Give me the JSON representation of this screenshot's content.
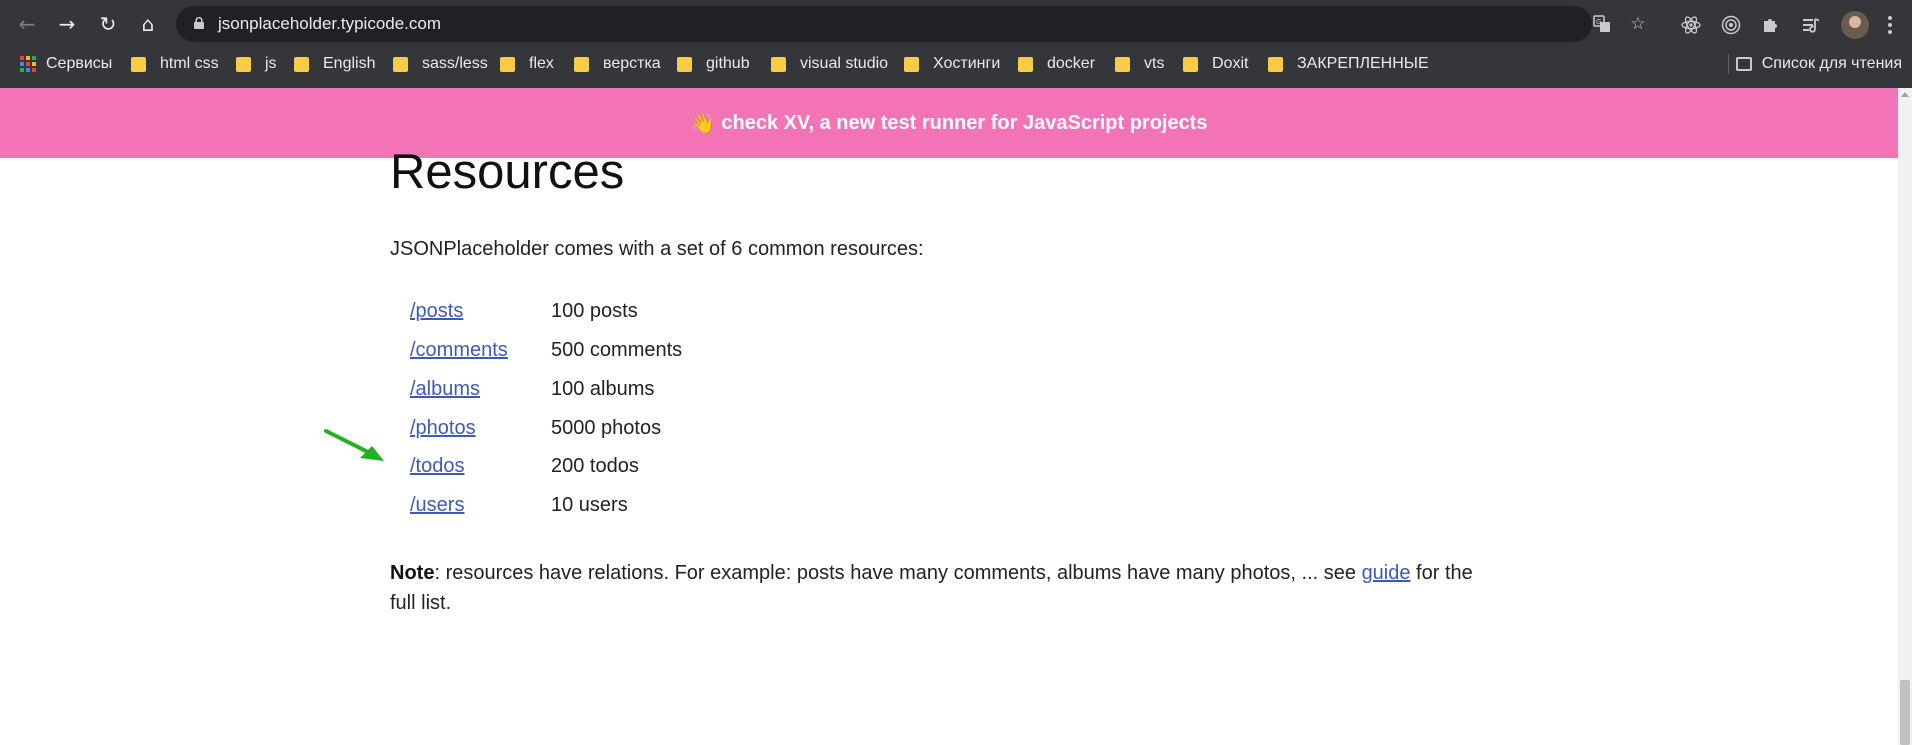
{
  "browser": {
    "url": "jsonplaceholder.typicode.com",
    "bookmarks": [
      {
        "label": "Сервисы"
      },
      {
        "label": "html css"
      },
      {
        "label": "js"
      },
      {
        "label": "English"
      },
      {
        "label": "sass/less"
      },
      {
        "label": "flex"
      },
      {
        "label": "верстка"
      },
      {
        "label": "github"
      },
      {
        "label": "visual studio"
      },
      {
        "label": "Хостинги"
      },
      {
        "label": "docker"
      },
      {
        "label": "vts"
      },
      {
        "label": "Doxit"
      },
      {
        "label": "ЗАКРЕПЛЕННЫЕ"
      }
    ],
    "reading_list": "Список для чтения",
    "icons": {
      "back": "back-arrow-icon",
      "forward": "forward-arrow-icon",
      "reload": "reload-icon",
      "home": "home-icon",
      "translate": "translate-icon",
      "bookmark": "star-icon",
      "react_devtools": "react-icon",
      "extension2": "target-icon",
      "extensions": "puzzle-icon",
      "media": "media-control-icon"
    }
  },
  "banner": {
    "emoji": "👋",
    "text": "check XV, a new test runner for JavaScript projects",
    "color": "#f374b6"
  },
  "page": {
    "heading": "Resources",
    "intro": "JSONPlaceholder comes with a set of 6 common resources:",
    "resources": [
      {
        "path": "/posts",
        "count": "100 posts"
      },
      {
        "path": "/comments",
        "count": "500 comments"
      },
      {
        "path": "/albums",
        "count": "100 albums"
      },
      {
        "path": "/photos",
        "count": "5000 photos"
      },
      {
        "path": "/todos",
        "count": "200 todos"
      },
      {
        "path": "/users",
        "count": "10 users"
      }
    ],
    "note": {
      "bold": "Note",
      "text_before": ": resources have relations. For example: posts have many comments, albums have many photos, ... see ",
      "link": "guide",
      "text_after": " for the full list."
    },
    "link_color": "#3d5bb5",
    "annotation_arrow_color": "#1fb31f"
  }
}
